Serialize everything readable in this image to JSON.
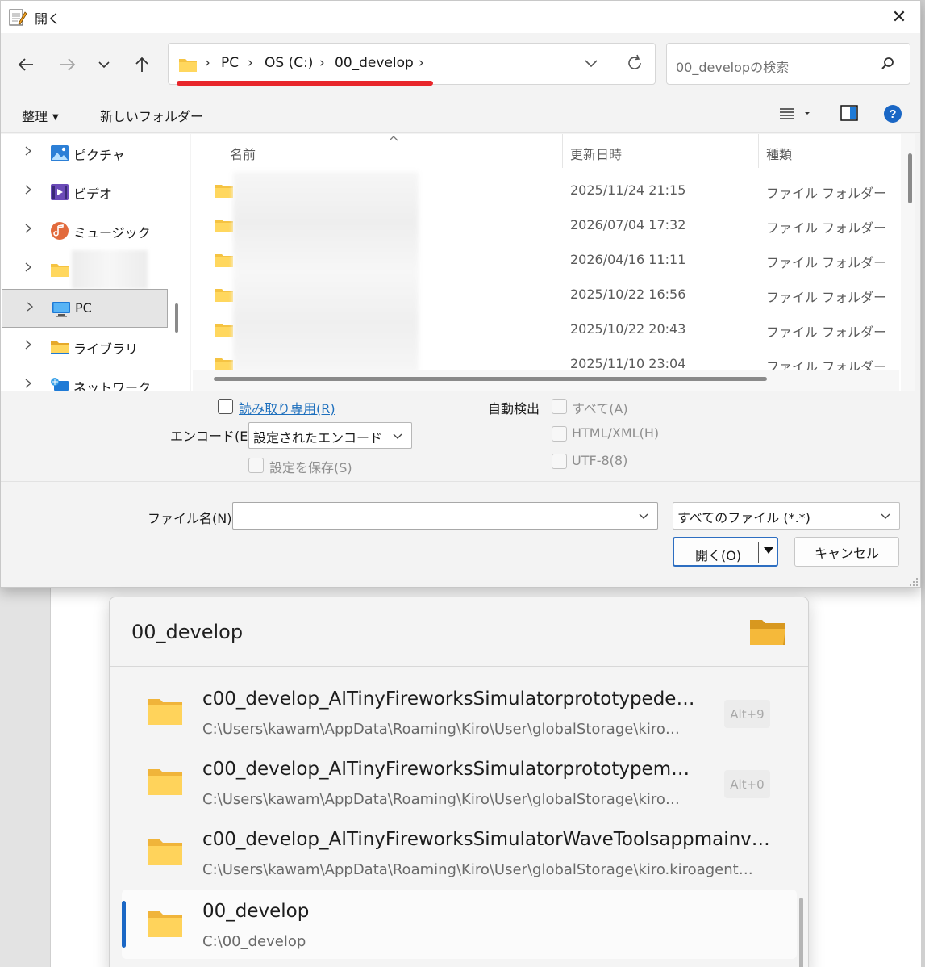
{
  "window": {
    "title": "開く",
    "close_glyph": "✕"
  },
  "address": {
    "crumbs": [
      "PC",
      "OS (C:)",
      "00_develop"
    ],
    "separator": "›",
    "search_placeholder": "00_developの検索"
  },
  "toolbar": {
    "organize": "整理",
    "new_folder": "新しいフォルダー"
  },
  "navpane": {
    "items": [
      {
        "label": "ピクチャ",
        "icon": "pictures-icon"
      },
      {
        "label": "ビデオ",
        "icon": "videos-icon"
      },
      {
        "label": "ミュージック",
        "icon": "music-icon"
      },
      {
        "label": "",
        "icon": "folder-icon"
      },
      {
        "label": "PC",
        "icon": "pc-icon",
        "selected": true
      },
      {
        "label": "ライブラリ",
        "icon": "library-icon"
      },
      {
        "label": "ネットワーク",
        "icon": "network-icon"
      }
    ]
  },
  "filelist": {
    "columns": {
      "name": "名前",
      "modified": "更新日時",
      "type": "種類"
    },
    "rows": [
      {
        "date": "2025/11/24 21:15",
        "type": "ファイル フォルダー"
      },
      {
        "date": "2026/07/04 17:32",
        "type": "ファイル フォルダー"
      },
      {
        "date": "2026/04/16 11:11",
        "type": "ファイル フォルダー"
      },
      {
        "date": "2025/10/22 16:56",
        "type": "ファイル フォルダー"
      },
      {
        "date": "2025/10/22 20:43",
        "type": "ファイル フォルダー"
      },
      {
        "date": "2025/11/10 23:04",
        "type": "ファイル フォルダー"
      }
    ]
  },
  "options": {
    "read_only": "読み取り専用(R)",
    "encode_label": "エンコード(E):",
    "encode_value": "設定されたエンコード",
    "save_setting": "設定を保存(S)",
    "auto_detect": "自動検出",
    "all": "すべて(A)",
    "html_xml": "HTML/XML(H)",
    "utf8": "UTF-8(8)"
  },
  "footer": {
    "filename_label": "ファイル名(N):",
    "filename_value": "",
    "filter_value": "すべてのファイル (*.*)",
    "open_label": "開く(O)",
    "cancel_label": "キャンセル"
  },
  "launcher": {
    "title": "00_develop",
    "results": [
      {
        "title": "c00_develop_AITinyFireworksSimulatorprototypede…",
        "path": "C:\\Users\\kawam\\AppData\\Roaming\\Kiro\\User\\globalStorage\\kiro…",
        "shortcut": "Alt+9"
      },
      {
        "title": "c00_develop_AITinyFireworksSimulatorprototypem…",
        "path": "C:\\Users\\kawam\\AppData\\Roaming\\Kiro\\User\\globalStorage\\kiro…",
        "shortcut": "Alt+0"
      },
      {
        "title": "c00_develop_AITinyFireworksSimulatorWaveToolsappmainv…",
        "path": "C:\\Users\\kawam\\AppData\\Roaming\\Kiro\\User\\globalStorage\\kiro.kiroagent…",
        "shortcut": ""
      },
      {
        "title": "00_develop",
        "path": "C:\\00_develop",
        "shortcut": "",
        "selected": true
      }
    ]
  },
  "colors": {
    "accent": "#1a67c5",
    "highlight_underline": "#e8262b",
    "folder": "#f5c342"
  }
}
